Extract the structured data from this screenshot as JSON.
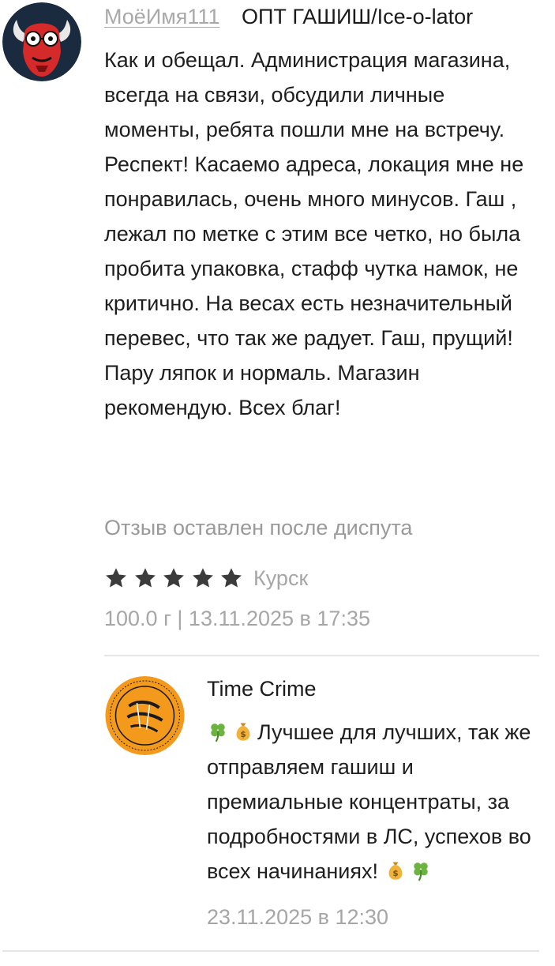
{
  "review": {
    "username": "МоёИмя111",
    "product": "ОПТ ГАШИШ/Ice-o-lator",
    "text": "Как и обещал. Администрация магазина, всегда на связи, обсудили личные моменты, ребята пошли мне на встречу. Респект! Касаемо адреса, локация мне не понравилась, очень много минусов. Гаш , лежал по метке с этим все четко, но была пробита упаковка, стафф чутка намок, не критично. На весах есть незначительный перевес, что так же радует. Гаш, прущий! Пару ляпок и нормаль. Магазин рекомендую. Всех благ!",
    "dispute_note": "Отзыв оставлен после диспута",
    "rating": 5,
    "rating_max": 5,
    "city": "Курск",
    "meta": "100.0 г | 13.11.2025 в 17:35"
  },
  "reply": {
    "shop_name": "Time Crime",
    "text_main": "Лучшее для лучших, так же отправляем гашиш и премиальные концентраты, за подробностями в ЛС, успехов во всех начинаниях!",
    "date": "23.11.2025 в 12:30"
  },
  "icons": {
    "user_avatar": "red-devil-face-avatar",
    "shop_avatar": "time-crime-logo",
    "star": "star-icon",
    "clover": "four-leaf-clover-emoji",
    "money_bag": "money-bag-emoji"
  },
  "colors": {
    "star": "#3b3b3b",
    "muted_text": "#a6a6a6",
    "shop_logo": "#f39a1c",
    "avatar_bg": "#1a2b40",
    "avatar_face": "#d42a2a"
  }
}
